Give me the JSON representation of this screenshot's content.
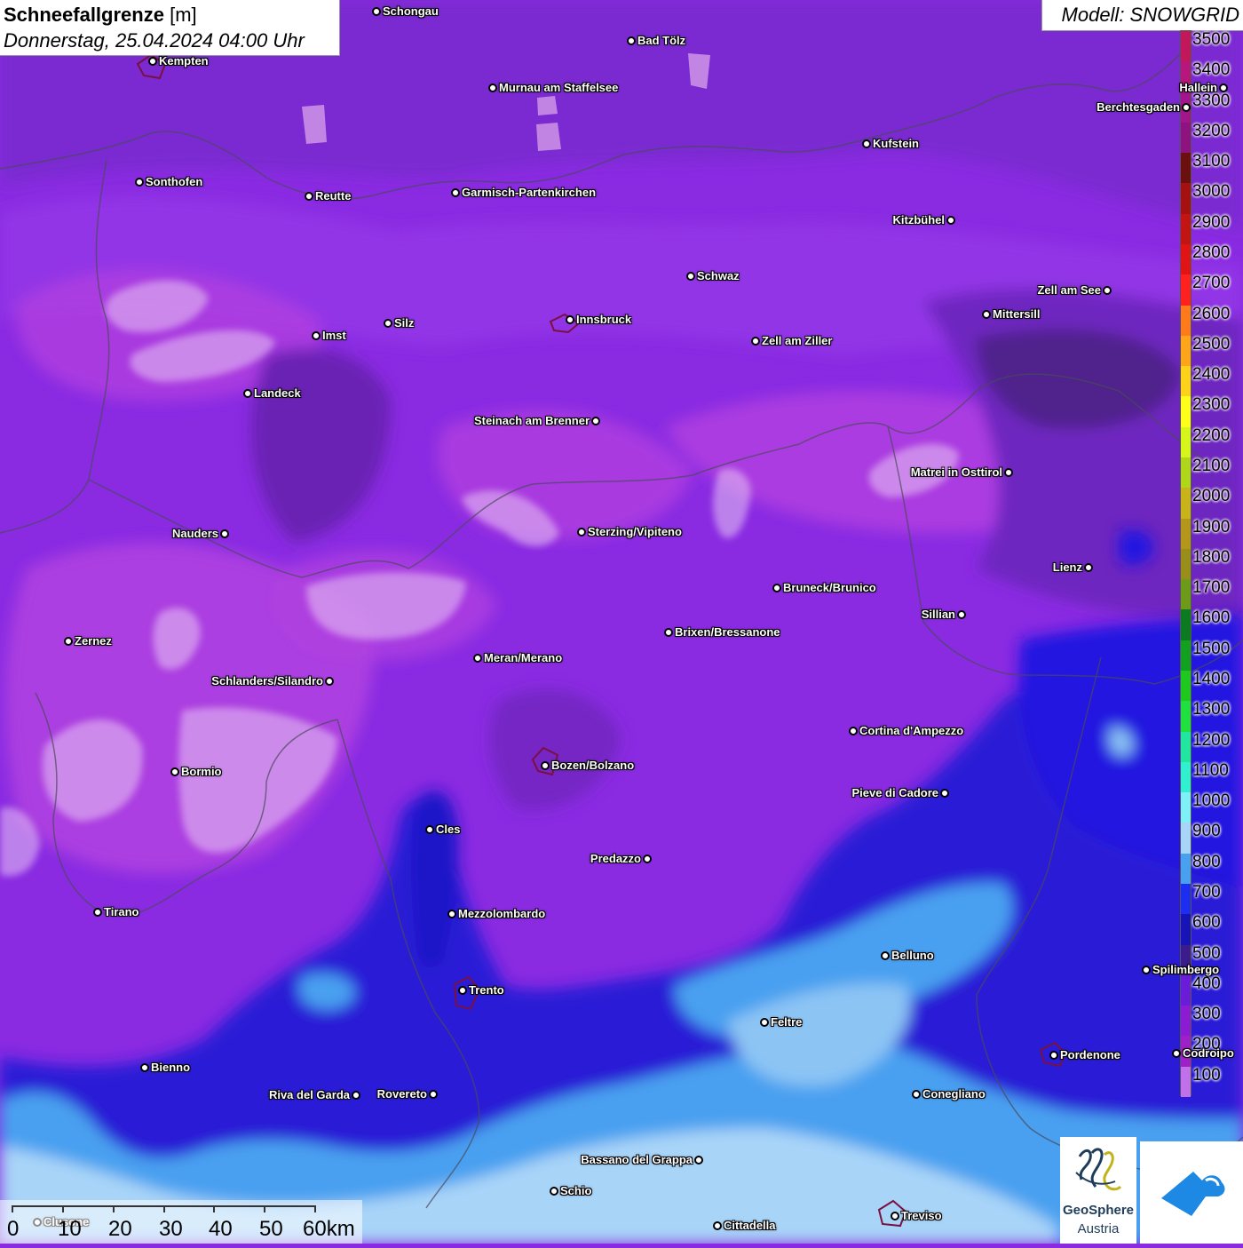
{
  "title": {
    "parameter": "Schneefallgrenze",
    "unit": "[m]",
    "datetime": "Donnerstag, 25.04.2024 04:00 Uhr"
  },
  "model": "Modell: SNOWGRID",
  "legend": {
    "labels": [
      "3500",
      "3400",
      "3300",
      "3200",
      "3100",
      "3000",
      "2900",
      "2800",
      "2700",
      "2600",
      "2500",
      "2400",
      "2300",
      "2200",
      "2100",
      "2000",
      "1900",
      "1800",
      "1700",
      "1600",
      "1500",
      "1400",
      "1300",
      "1200",
      "1100",
      "1000",
      "900",
      "800",
      "700",
      "600",
      "500",
      "400",
      "300",
      "200",
      "100"
    ],
    "colors": [
      "#c2185b",
      "#b7167a",
      "#a3158a",
      "#8e1280",
      "#6b0f0f",
      "#a51010",
      "#c31414",
      "#e01414",
      "#ff2020",
      "#ff7a1a",
      "#ffa51a",
      "#ffd21a",
      "#ffff1a",
      "#d6f51a",
      "#b0d61a",
      "#c8b41a",
      "#b4961a",
      "#9a8e1a",
      "#6e9a1a",
      "#0c7a20",
      "#12a020",
      "#1ec81e",
      "#20e040",
      "#20e6a0",
      "#30f0d0",
      "#80f0f8",
      "#a8d4f8",
      "#4aa0f0",
      "#1e2ef0",
      "#1614b4",
      "#3a1c8c",
      "#6a1cd8",
      "#8c1cd4",
      "#a020c8",
      "#c070e8"
    ]
  },
  "cities": [
    {
      "name": "Schongau"
    },
    {
      "name": "Bad Tölz"
    },
    {
      "name": "Kempten"
    },
    {
      "name": "Murnau am Staffelsee"
    },
    {
      "name": "Hallein"
    },
    {
      "name": "Berchtesgaden"
    },
    {
      "name": "Kufstein"
    },
    {
      "name": "Sonthofen"
    },
    {
      "name": "Reutte"
    },
    {
      "name": "Garmisch-Partenkirchen"
    },
    {
      "name": "Kitzbühel"
    },
    {
      "name": "Schwaz"
    },
    {
      "name": "Zell am See"
    },
    {
      "name": "Mittersill"
    },
    {
      "name": "Innsbruck"
    },
    {
      "name": "Silz"
    },
    {
      "name": "Imst"
    },
    {
      "name": "Zell am Ziller"
    },
    {
      "name": "Landeck"
    },
    {
      "name": "Steinach am Brenner"
    },
    {
      "name": "Matrei in Osttirol"
    },
    {
      "name": "Nauders"
    },
    {
      "name": "Sterzing/Vipiteno"
    },
    {
      "name": "Lienz"
    },
    {
      "name": "Bruneck/Brunico"
    },
    {
      "name": "Sillian"
    },
    {
      "name": "Brixen/Bressanone"
    },
    {
      "name": "Zernez"
    },
    {
      "name": "Meran/Merano"
    },
    {
      "name": "Schlanders/Silandro"
    },
    {
      "name": "Cortina d'Ampezzo"
    },
    {
      "name": "Bozen/Bolzano"
    },
    {
      "name": "Bormio"
    },
    {
      "name": "Pieve di Cadore"
    },
    {
      "name": "Cles"
    },
    {
      "name": "Predazzo"
    },
    {
      "name": "Tirano"
    },
    {
      "name": "Mezzolombardo"
    },
    {
      "name": "Belluno"
    },
    {
      "name": "Spilimbergo"
    },
    {
      "name": "Trento"
    },
    {
      "name": "Feltre"
    },
    {
      "name": "Pordenone"
    },
    {
      "name": "Codroipo"
    },
    {
      "name": "Bienno"
    },
    {
      "name": "Riva del Garda"
    },
    {
      "name": "Rovereto"
    },
    {
      "name": "Conegliano"
    },
    {
      "name": "Bassano del Grappa"
    },
    {
      "name": "Schio"
    },
    {
      "name": "Treviso"
    },
    {
      "name": "Cittadella"
    },
    {
      "name": "Clusone"
    }
  ],
  "scale": {
    "labels": [
      "0",
      "10",
      "20",
      "30",
      "40",
      "50",
      "60km"
    ]
  },
  "logos": {
    "geosphere_name": "GeoSphere",
    "geosphere_sub": "Austria"
  }
}
